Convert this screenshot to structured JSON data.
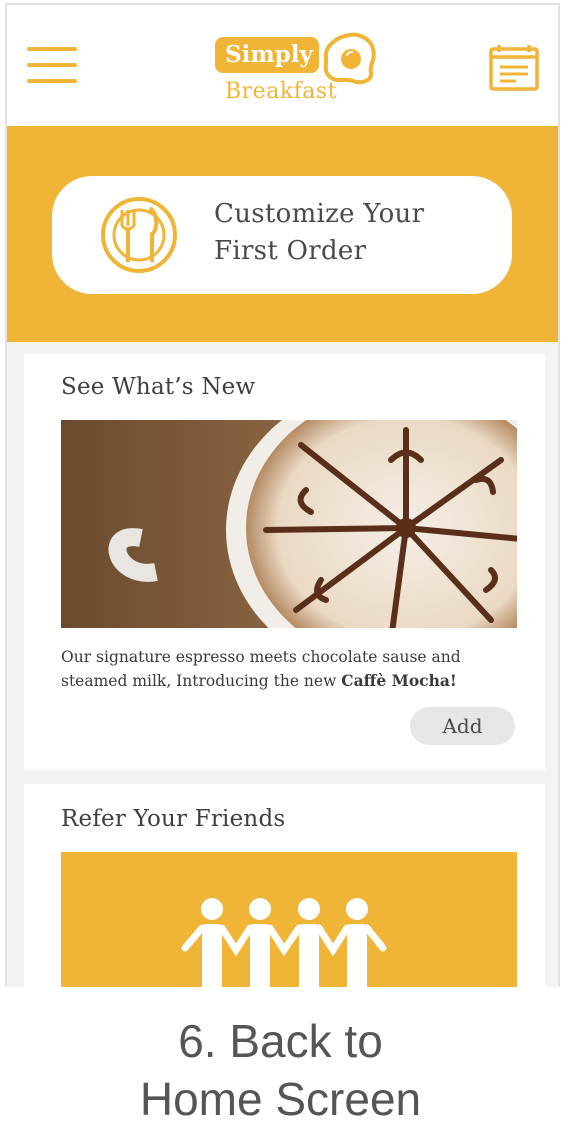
{
  "app": {
    "logo_top": "Simply",
    "logo_bottom": "Breakfast"
  },
  "colors": {
    "brand": "#f0b436",
    "card_bg": "#ffffff",
    "page_bg": "#f3f3f3",
    "text": "#3f3f3f",
    "button_bg": "#e6e6e6"
  },
  "icons": {
    "menu": "hamburger-menu-icon",
    "calendar": "calendar-icon",
    "logo": "fried-egg-icon",
    "cta": "plate-fork-knife-icon",
    "refer": "people-holding-hands-icon"
  },
  "banner": {
    "cta_line1": "Customize Your",
    "cta_line2": "First Order"
  },
  "whats_new": {
    "title": "See What’s New",
    "image": "caffe mocha latte art",
    "desc_text": "Our signature espresso meets chocolate sause and steamed milk, Introducing the new ",
    "desc_bold": "Caffè Mocha!",
    "add_label": "Add"
  },
  "refer": {
    "title": "Refer Your Friends"
  },
  "caption": {
    "line1": "6. Back to",
    "line2": "Home Screen"
  }
}
